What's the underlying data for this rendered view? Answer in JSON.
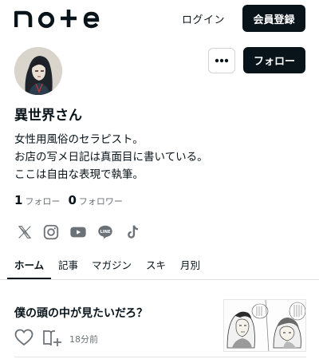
{
  "header": {
    "logo_text": "note",
    "login_label": "ログイン",
    "signup_label": "会員登録"
  },
  "profile": {
    "name": "異世界さん",
    "bio": [
      "女性用風俗のセラピスト。",
      "お店の写メ日記は真面目に書いている。",
      "ここは自由な表現で執筆。"
    ],
    "follow_button_label": "フォロー",
    "following_count": "1",
    "following_label": "フォロー",
    "followers_count": "0",
    "followers_label": "フォロワー",
    "social_icons": [
      "x-icon",
      "instagram-icon",
      "youtube-icon",
      "line-icon",
      "tiktok-icon"
    ]
  },
  "tabs": [
    {
      "label": "ホーム",
      "active": true
    },
    {
      "label": "記事",
      "active": false
    },
    {
      "label": "マガジン",
      "active": false
    },
    {
      "label": "スキ",
      "active": false
    },
    {
      "label": "月別",
      "active": false
    }
  ],
  "article": {
    "title": "僕の頭の中が見たいだろ？",
    "time_ago": "18分前"
  },
  "colors": {
    "text": "#08131a",
    "button_dark": "#08131a",
    "muted": "#6b7277",
    "divider": "#e2e4e6"
  }
}
